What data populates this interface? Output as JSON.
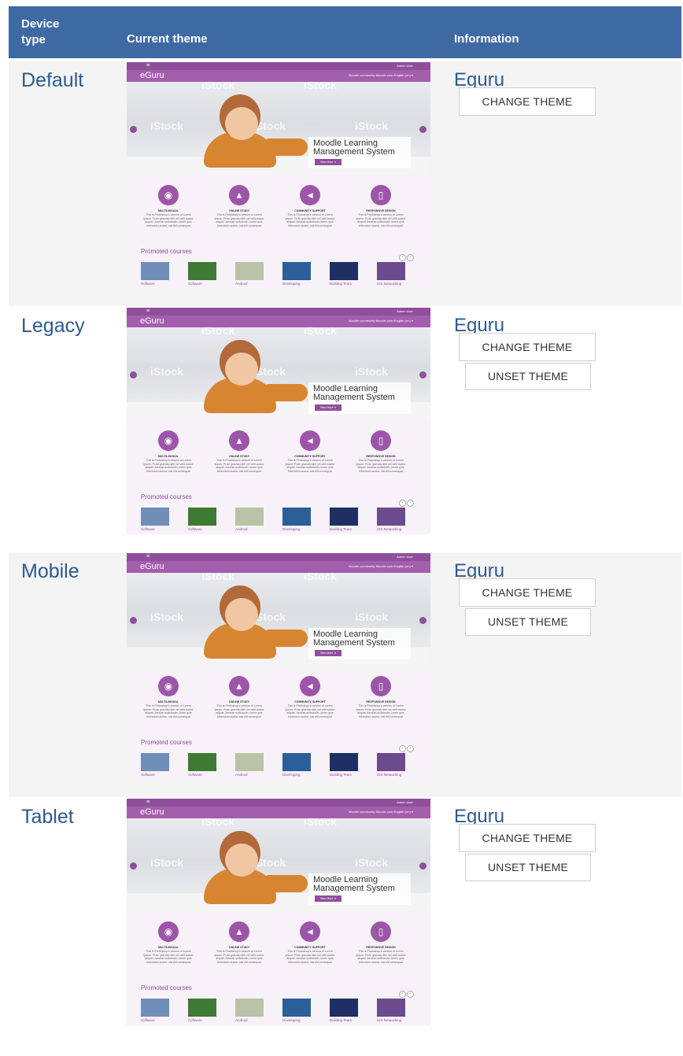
{
  "header": {
    "device_type": "Device type",
    "current_theme": "Current theme",
    "information": "Information"
  },
  "rows": [
    {
      "device": "Default",
      "theme_name": "Eguru",
      "change_label": "CHANGE THEME"
    },
    {
      "device": "Legacy",
      "theme_name": "Eguru",
      "change_label": "CHANGE THEME",
      "unset_label": "UNSET THEME"
    },
    {
      "device": "Mobile",
      "theme_name": "Eguru",
      "change_label": "CHANGE THEME",
      "unset_label": "UNSET THEME"
    },
    {
      "device": "Tablet",
      "theme_name": "Eguru",
      "change_label": "CHANGE THEME",
      "unset_label": "UNSET THEME"
    }
  ],
  "preview": {
    "menu_icon": "≡",
    "user": "Admin User",
    "logo": "eGuru",
    "nav_links": "Moodle community    Moodle.com    English (en) ▾",
    "watermark": "iStock",
    "caption_line1": "Moodle Learning",
    "caption_line2": "Management System",
    "caption_button": "View More ➜",
    "features": [
      {
        "icon_name": "globe-icon",
        "glyph": "◉",
        "title": "MULTILINGUAL",
        "text": "This is Photoshop's version of Lorem Ipsum. Proin gravida nibh vel velit auctor aliquet. Aenean sollicitudin, lorem quis bibendum auctor, nisi elit consequat"
      },
      {
        "icon_name": "graduation-cap-icon",
        "glyph": "▲",
        "title": "ONLINE STUDY",
        "text": "This is Photoshop's version of Lorem Ipsum. Proin gravida nibh vel velit auctor aliquet. Aenean sollicitudin, lorem quis bibendum auctor, nisi elit consequat"
      },
      {
        "icon_name": "megaphone-icon",
        "glyph": "◄",
        "title": "COMMUNITY SUPPORT",
        "text": "This is Photoshop's version of Lorem Ipsum. Proin gravida nibh vel velit auctor aliquet. Aenean sollicitudin, lorem quis bibendum auctor, nisi elit consequat"
      },
      {
        "icon_name": "tablet-icon",
        "glyph": "▯",
        "title": "RESPONSIVE DESIGN",
        "text": "This is Photoshop's version of Lorem Ipsum. Proin gravida nibh vel velit auctor aliquet. Aenean sollicitudin, lorem quis bibendum auctor, nisi elit consequat"
      }
    ],
    "promoted": "Promoted courses",
    "courses": [
      {
        "label": "Software",
        "color": "#6f8fb8"
      },
      {
        "label": "Software",
        "color": "#3f7a35"
      },
      {
        "label": "Android",
        "color": "#b9c3a6"
      },
      {
        "label": "Developing",
        "color": "#2b5f98"
      },
      {
        "label": "Building Team",
        "color": "#1d2f63"
      },
      {
        "label": "iOS Networking",
        "color": "#6b4a8e"
      }
    ]
  },
  "colors": {
    "header_bg": "#3e6aa3",
    "title_blue": "#2c5a8f",
    "theme_purple": "#8f4f9b"
  }
}
